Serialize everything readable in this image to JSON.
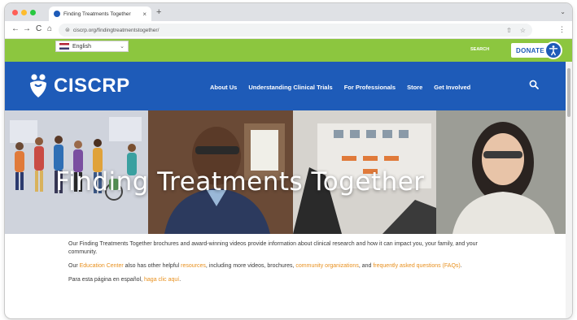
{
  "browser": {
    "tab_title": "Finding Treatments Together",
    "tab_close": "×",
    "new_tab": "+",
    "tab_menu": "⌄",
    "url": "ciscrp.org/findingtreatmentstogether/",
    "omni_share": "⇧",
    "omni_star": "☆",
    "menu": "⋮",
    "nav": {
      "back": "←",
      "forward": "→",
      "reload": "C",
      "home": "⌂"
    }
  },
  "utility": {
    "language": "English",
    "language_caret": "⌄",
    "link": "SEARCH",
    "donate": "DONATE"
  },
  "nav": {
    "logo": "CISCRP",
    "links": [
      "About Us",
      "Understanding Clinical Trials",
      "For Professionals",
      "Store",
      "Get Involved"
    ]
  },
  "hero": {
    "title": "Finding Treatments Together"
  },
  "content": {
    "p1": "Our Finding Treatments Together brochures and award-winning videos provide information about clinical research and how it can impact you, your family, and your community.",
    "p2_a": "Our ",
    "p2_link1": "Education Center",
    "p2_b": " also has other helpful ",
    "p2_link2": "resources",
    "p2_c": ", including more videos, brochures, ",
    "p2_link3": "community organizations",
    "p2_d": ", and ",
    "p2_link4": "frequently asked questions (FAQs)",
    "p2_e": ".",
    "p3_a": "Para esta página en español, ",
    "p3_link": "haga clic aquí",
    "p3_b": "."
  },
  "colors": {
    "green": "#8cc63f",
    "blue": "#1e5bb8",
    "orange_link": "#e8901e"
  }
}
